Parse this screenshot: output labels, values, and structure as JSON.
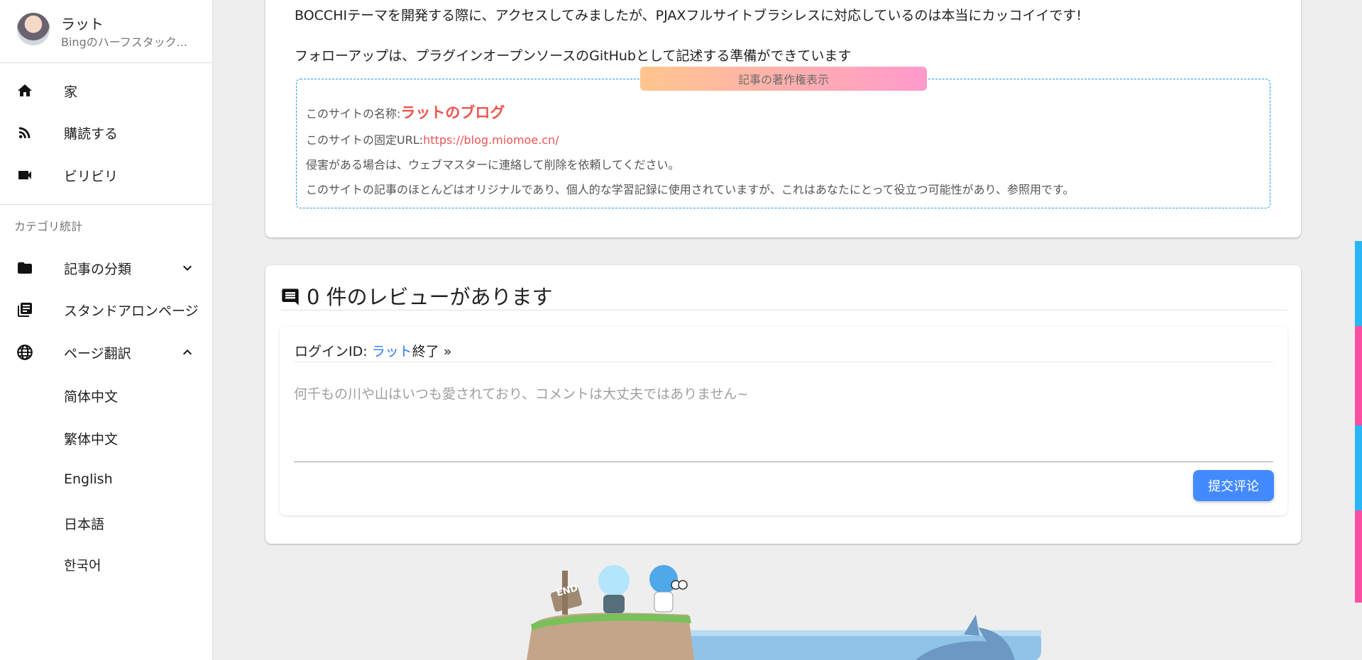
{
  "profile": {
    "name": "ラット",
    "subtitle": "Bingのハーフスタック..."
  },
  "nav": {
    "home": "家",
    "subscribe": "購読する",
    "bilibili": "ビリビリ"
  },
  "category_header": "カテゴリ統計",
  "categories": {
    "articles": "記事の分類",
    "standalone": "スタンドアロンページ",
    "translate": "ページ翻訳"
  },
  "languages": [
    "简体中文",
    "繁体中文",
    "English",
    "日本語",
    "한국어"
  ],
  "article": {
    "para1": "BOCCHIテーマを開発する際に、アクセスしてみましたが、PJAXフルサイトブラシレスに対応しているのは本当にカッコイイです!",
    "para2": "フォローアップは、プラグインオープンソースのGitHubとして記述する準備ができています"
  },
  "copyright": {
    "tag": "記事の著作権表示",
    "name_label": "このサイトの名称:",
    "name_value": "ラットのブログ",
    "url_label": "このサイトの固定URL:",
    "url_value": "https://blog.miomoe.cn/",
    "line3": "侵害がある場合は、ウェブマスターに連絡して削除を依頼してください。",
    "line4": "このサイトの記事のほとんどはオリジナルであり、個人的な学習記録に使用されていますが、これはあなたにとって役立つ可能性があり、参照用です。"
  },
  "comments": {
    "title": "0 件のレビューがあります",
    "login_prefix": "ログインID: ",
    "login_user": "ラット",
    "logout": "終了 »",
    "placeholder": "何千もの川や山はいつも愛されており、コメントは大丈夫ではありません~",
    "submit": "提交评论"
  },
  "decoration": {
    "sign_text": "END"
  },
  "colors": {
    "accent_blue": "#448aff",
    "link_red": "#ef5350",
    "tag_gradient_start": "#ffc68e",
    "tag_gradient_end": "#ff9acb"
  }
}
